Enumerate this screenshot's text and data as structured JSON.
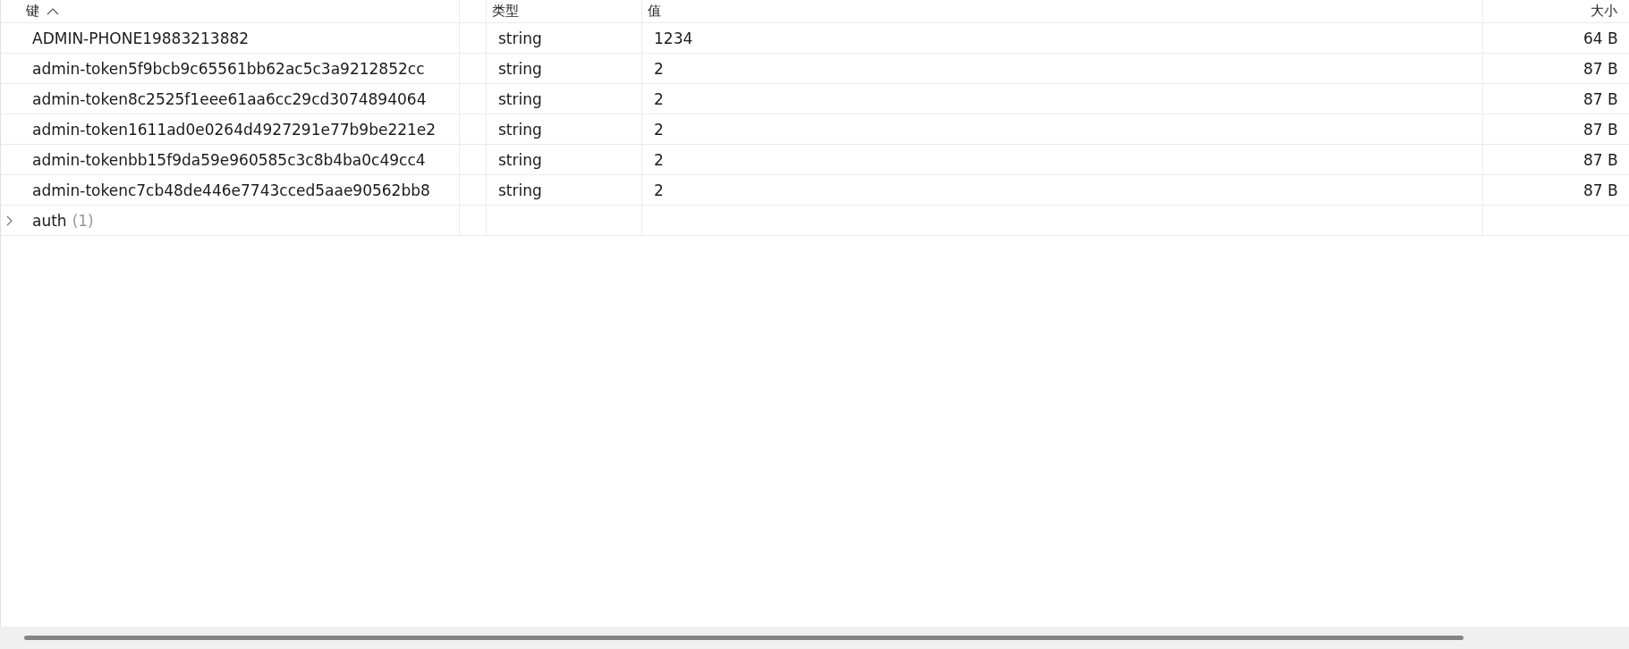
{
  "table": {
    "columns": [
      {
        "kind": "text",
        "label": "键",
        "sorted": true
      },
      {
        "kind": "blank"
      },
      {
        "kind": "text",
        "label": "类型",
        "sorted": false
      },
      {
        "kind": "text",
        "label": "值",
        "sorted": false
      },
      {
        "kind": "text",
        "label": "大小",
        "sorted": false
      }
    ],
    "rows": [
      {
        "kind": "entry",
        "key": "ADMIN-PHONE19883213882",
        "type": "string",
        "value": "1234",
        "size": "64 B"
      },
      {
        "kind": "entry",
        "key": "admin-token5f9bcb9c65561bb62ac5c3a9212852cc",
        "type": "string",
        "value": "2",
        "size": "87 B"
      },
      {
        "kind": "entry",
        "key": "admin-token8c2525f1eee61aa6cc29cd3074894064",
        "type": "string",
        "value": "2",
        "size": "87 B"
      },
      {
        "kind": "entry",
        "key": "admin-token1611ad0e0264d4927291e77b9be221e2",
        "type": "string",
        "value": "2",
        "size": "87 B"
      },
      {
        "kind": "entry",
        "key": "admin-tokenbb15f9da59e960585c3c8b4ba0c49cc4",
        "type": "string",
        "value": "2",
        "size": "87 B"
      },
      {
        "kind": "entry",
        "key": "admin-tokenc7cb48de446e7743cced5aae90562bb8",
        "type": "string",
        "value": "2",
        "size": "87 B"
      },
      {
        "kind": "folder",
        "key": "auth",
        "count": "(1)",
        "expanded": false
      }
    ]
  }
}
